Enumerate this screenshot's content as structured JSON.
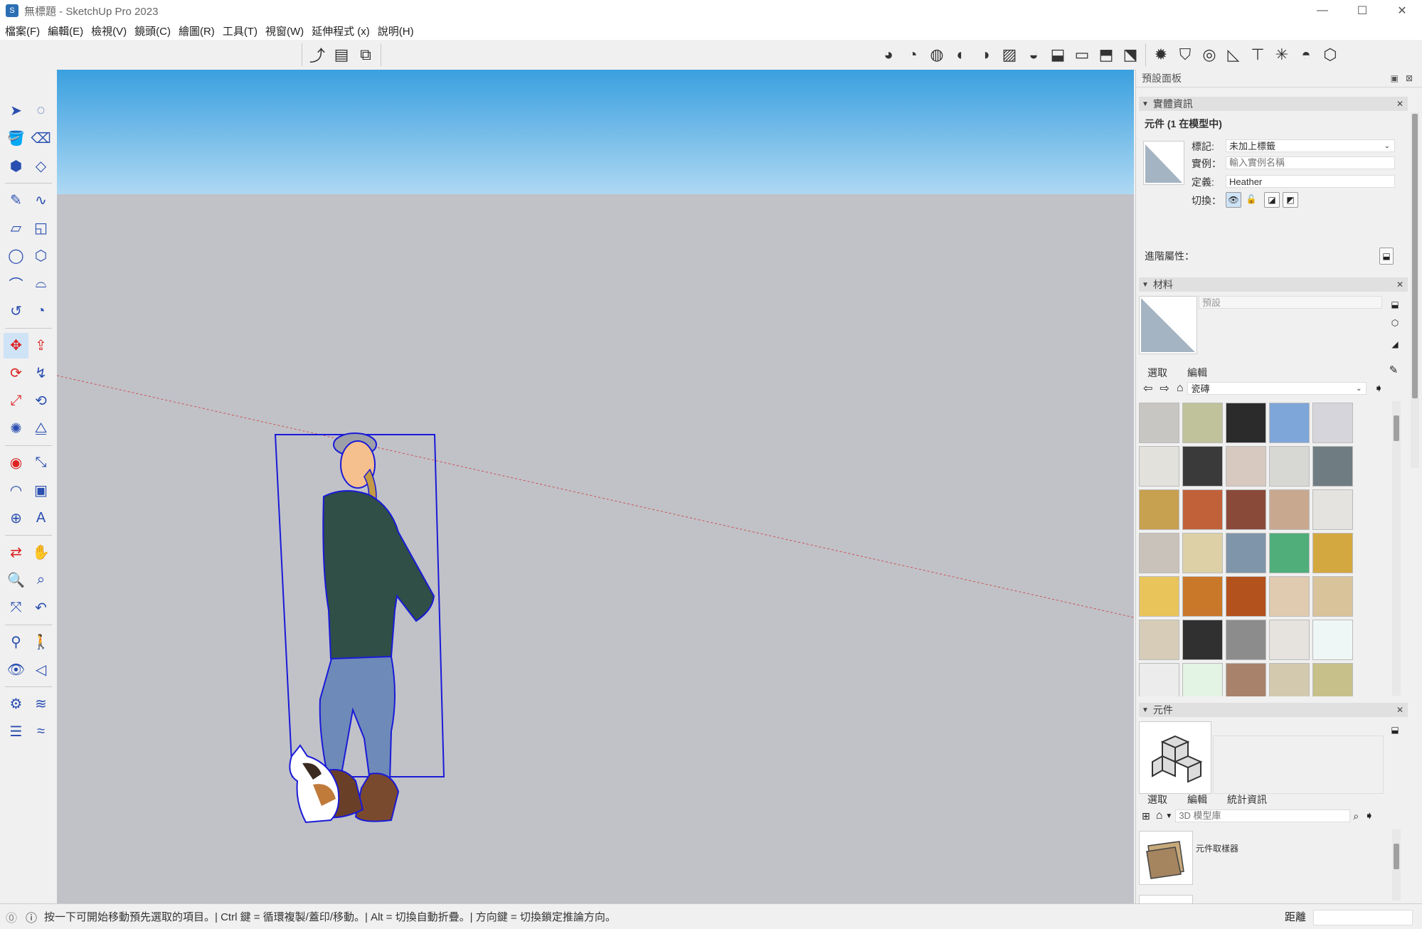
{
  "window": {
    "title": "無標題 - SketchUp Pro 2023",
    "controls": [
      "—",
      "☐",
      "✕"
    ]
  },
  "menu": [
    "檔案(F)",
    "編輯(E)",
    "檢視(V)",
    "鏡頭(C)",
    "繪圖(R)",
    "工具(T)",
    "視窗(W)",
    "延伸程式 (x)",
    "說明(H)"
  ],
  "panel": {
    "title": "預設面板",
    "entity_info": {
      "header": "實體資訊",
      "type_label": "元件 (1 在模型中)",
      "tag_label": "標記:",
      "tag_value": "未加上標籤",
      "instance_label": "實例：",
      "instance_placeholder": "輸入實例名稱",
      "definition_label": "定義:",
      "definition_value": "Heather",
      "toggle_label": "切換：",
      "advanced_label": "進階屬性："
    },
    "materials": {
      "header": "材料",
      "current_name": "預設",
      "tabs": [
        "選取",
        "編輯"
      ],
      "library": "瓷磚",
      "swatch_colors": [
        [
          "#c8c6c2",
          "#bfc29a",
          "#2b2b2b",
          "#7ea6d8",
          "#d6d5dc"
        ],
        [
          "#e2e1dc",
          "#3a3a3a",
          "#d7c9bf",
          "#d7d8d4",
          "#6f7d82"
        ],
        [
          "#c7a050",
          "#c0613a",
          "#8a4a3a",
          "#c9a890",
          "#e4e3df"
        ],
        [
          "#c8c2bb",
          "#ddd0a6",
          "#7f95aa",
          "#4fae7a",
          "#d4a840"
        ],
        [
          "#e8c45a",
          "#c9782a",
          "#b4521e",
          "#e0cbb0",
          "#d9c39b"
        ],
        [
          "#d6ccb8",
          "#303030",
          "#8c8c8c",
          "#e6e3df",
          "#eef6f6"
        ],
        [
          "#ececec",
          "#e4f4e4",
          "#a8826a",
          "#d3c9ae",
          "#c8c08a"
        ]
      ]
    },
    "components": {
      "header": "元件",
      "tabs": [
        "選取",
        "編輯",
        "統計資訊"
      ],
      "search_placeholder": "3D 模型庫",
      "item_label": "元件取樣器"
    }
  },
  "status": {
    "hint": "按一下可開始移動預先選取的項目。| Ctrl 鍵 = 循環複製/蓋印/移動。| Alt = 切換自動折疊。| 方向鍵 = 切換鎖定推論方向。",
    "measurement_label": "距離"
  }
}
